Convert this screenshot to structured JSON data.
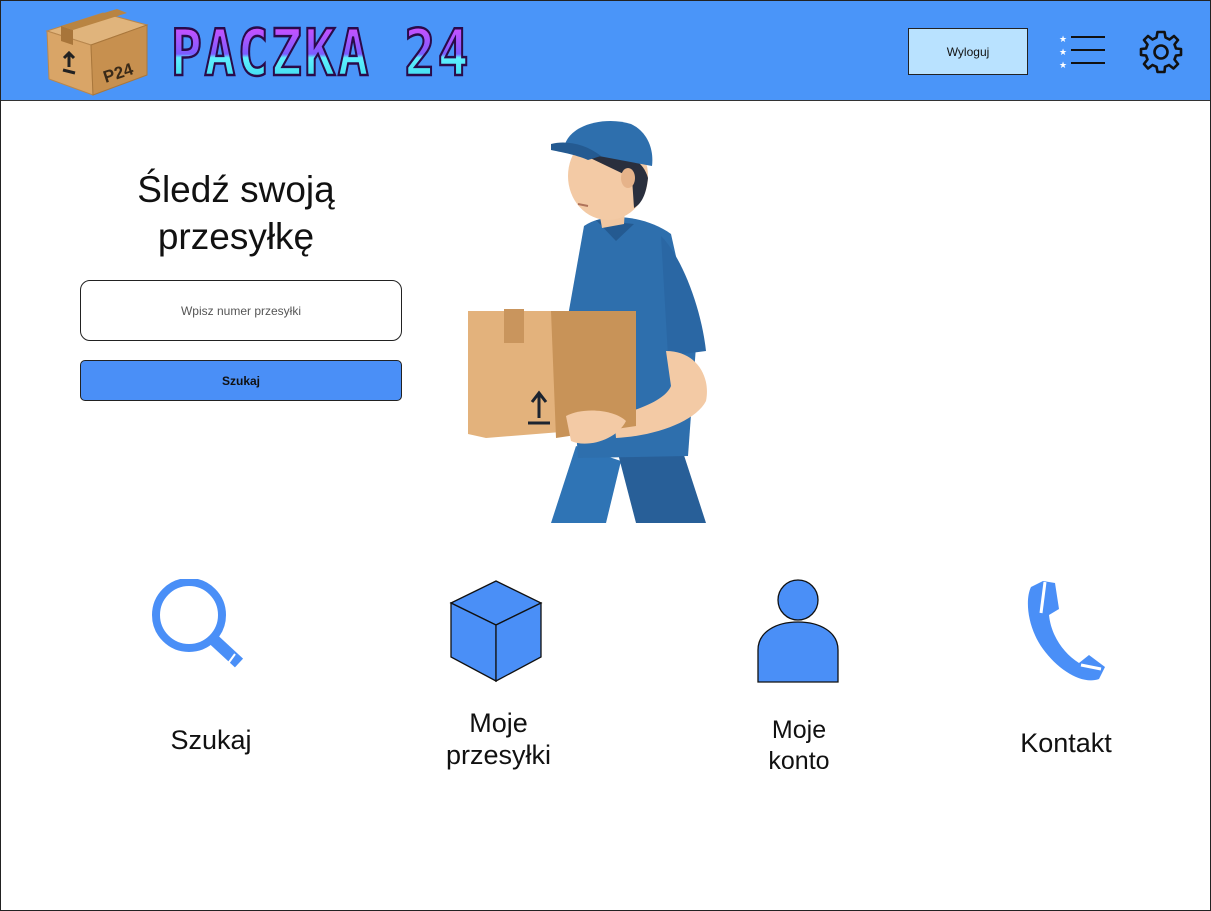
{
  "header": {
    "brand_text": "PACZKA 24",
    "logo_label": "P24",
    "logout_label": "Wyloguj",
    "accent_color": "#4a95f9"
  },
  "tracking": {
    "title_line1": "Śledź swoją",
    "title_line2": "przesyłkę",
    "input_placeholder": "Wpisz numer przesyłki",
    "search_button_label": "Szukaj"
  },
  "nav": {
    "search": {
      "line1": "Szukaj",
      "icon": "magnifier-icon"
    },
    "parcels": {
      "line1": "Moje",
      "line2": "przesyłki",
      "icon": "cube-icon"
    },
    "account": {
      "line1": "Moje",
      "line2": "konto",
      "icon": "user-icon"
    },
    "contact": {
      "line1": "Kontakt",
      "icon": "phone-icon"
    }
  }
}
